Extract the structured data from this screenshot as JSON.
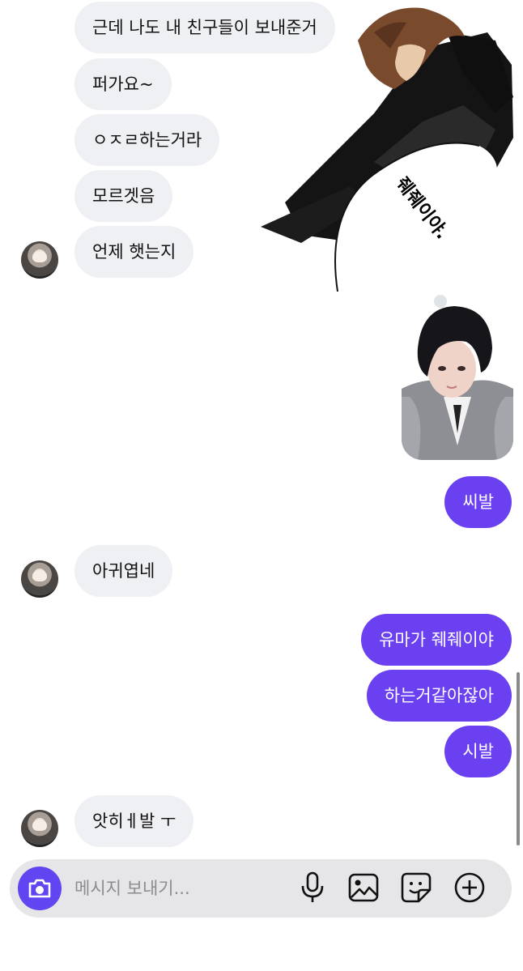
{
  "messages": {
    "incoming_group_1": [
      "근데 나도 내 친구들이 보내준거",
      "퍼가요~",
      "ㅇㅈㄹ하는거라",
      "모르겟음",
      "언제 햇는지"
    ],
    "incoming_2": "아귀엽네",
    "outgoing_1": "씨발",
    "outgoing_group_2": [
      "유마가 줴줴이야",
      "하는거같아잖아",
      "시발"
    ],
    "incoming_3": "앗히ㅔ발 ㅜ"
  },
  "sticker": {
    "caption": "줴줴이야."
  },
  "composer": {
    "placeholder": "메시지 보내기...",
    "icons": [
      "camera-icon",
      "microphone-icon",
      "image-icon",
      "sticker-icon",
      "plus-circle-icon"
    ],
    "accent": "#6045f0"
  },
  "colors": {
    "incoming_bubble": "#eff0f3",
    "outgoing_bubble": "#6a40f1"
  }
}
